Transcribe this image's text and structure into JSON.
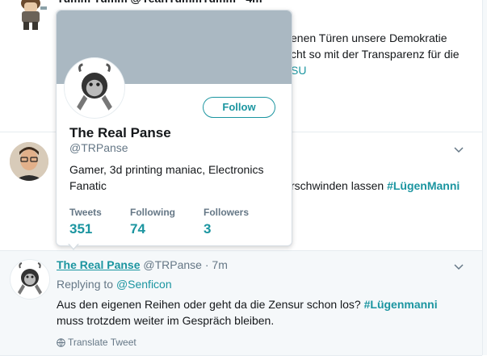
{
  "tweet1": {
    "header": "Yumm Yumm @YeahYummYumm · 4m",
    "line1": "enen Türen unsere Demokratie",
    "line2": "cht so mit der Transparenz für die",
    "line3": "SU"
  },
  "tweet2": {
    "line1_text": "rschwinden lassen ",
    "line1_hashtag": "#LügenManni"
  },
  "tweet3": {
    "name": "The Real Panse",
    "handle": "@TRPanse",
    "time": "· 7m",
    "replying_prefix": "Replying to ",
    "replying_handle": "@Senficon",
    "body_line1": "Aus den eigenen Reihen oder geht da die Zensur schon los? ",
    "body_hashtag": "#Lügenmanni",
    "body_line2": "muss trotzdem weiter im Gespräch bleiben.",
    "translate": "Translate Tweet"
  },
  "hovercard": {
    "follow_label": "Follow",
    "name": "The Real Panse",
    "handle": "@TRPanse",
    "bio": "Gamer, 3d printing maniac, Electronics Fanatic",
    "stats": [
      {
        "label": "Tweets",
        "value": "351"
      },
      {
        "label": "Following",
        "value": "74"
      },
      {
        "label": "Followers",
        "value": "3"
      }
    ]
  },
  "colors": {
    "accent": "#1b95a0",
    "muted": "#657786",
    "banner": "#aab8c2"
  }
}
